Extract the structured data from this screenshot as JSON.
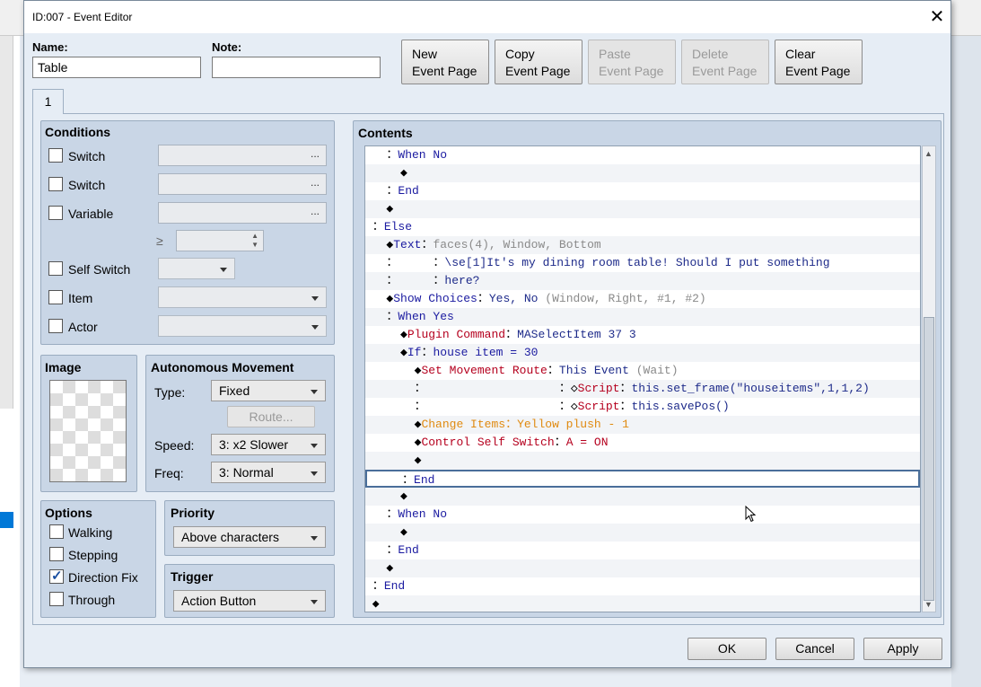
{
  "dialog": {
    "title": "ID:007 - Event Editor",
    "name_label": "Name:",
    "name_value": "Table",
    "note_label": "Note:",
    "note_value": "",
    "page_buttons": [
      {
        "line1": "New",
        "line2": "Event Page",
        "enabled": true
      },
      {
        "line1": "Copy",
        "line2": "Event Page",
        "enabled": true
      },
      {
        "line1": "Paste",
        "line2": "Event Page",
        "enabled": false
      },
      {
        "line1": "Delete",
        "line2": "Event Page",
        "enabled": false
      },
      {
        "line1": "Clear",
        "line2": "Event Page",
        "enabled": true
      }
    ],
    "tab_label": "1",
    "close_icon": "close-icon"
  },
  "conditions": {
    "title": "Conditions",
    "switch1": "Switch",
    "switch2": "Switch",
    "variable": "Variable",
    "ellipsis": "...",
    "ge_symbol": "≥",
    "self_switch": "Self Switch",
    "item": "Item",
    "actor": "Actor"
  },
  "image": {
    "title": "Image"
  },
  "autonomous": {
    "title": "Autonomous Movement",
    "type_label": "Type:",
    "type_value": "Fixed",
    "route_button": "Route...",
    "speed_label": "Speed:",
    "speed_value": "3: x2 Slower",
    "freq_label": "Freq:",
    "freq_value": "3: Normal"
  },
  "options": {
    "title": "Options",
    "walking": "Walking",
    "stepping": "Stepping",
    "direction_fix": "Direction Fix",
    "through": "Through",
    "checked": {
      "walking": false,
      "stepping": false,
      "direction_fix": true,
      "through": false
    }
  },
  "priority": {
    "title": "Priority",
    "value": "Above characters"
  },
  "trigger": {
    "title": "Trigger",
    "value": "Action Button"
  },
  "contents": {
    "title": "Contents",
    "rows": [
      [
        {
          "t": "   ：",
          "c": "c-black"
        },
        {
          "t": "When No",
          "c": "c-blue"
        }
      ],
      [
        {
          "t": "     ◆",
          "c": "c-black"
        }
      ],
      [
        {
          "t": "   ：",
          "c": "c-black"
        },
        {
          "t": "End",
          "c": "c-blue"
        }
      ],
      [
        {
          "t": "   ◆",
          "c": "c-black"
        }
      ],
      [
        {
          "t": " ：",
          "c": "c-black"
        },
        {
          "t": "Else",
          "c": "c-blue"
        }
      ],
      [
        {
          "t": "   ◆",
          "c": "c-black"
        },
        {
          "t": "Text",
          "c": "c-blue"
        },
        {
          "t": "：",
          "c": "c-black"
        },
        {
          "t": "faces(4), Window, Bottom",
          "c": "c-gray"
        }
      ],
      [
        {
          "t": "   ：     ：",
          "c": "c-black"
        },
        {
          "t": "\\se[1]It's my dining room table! Should I put something",
          "c": "c-dblue"
        }
      ],
      [
        {
          "t": "   ：     ：",
          "c": "c-black"
        },
        {
          "t": "here?",
          "c": "c-dblue"
        }
      ],
      [
        {
          "t": "   ◆",
          "c": "c-black"
        },
        {
          "t": "Show Choices",
          "c": "c-blue"
        },
        {
          "t": "：",
          "c": "c-black"
        },
        {
          "t": "Yes, No ",
          "c": "c-dblue"
        },
        {
          "t": "(Window, Right, #1, #2)",
          "c": "c-gray"
        }
      ],
      [
        {
          "t": "   ：",
          "c": "c-black"
        },
        {
          "t": "When Yes",
          "c": "c-blue"
        }
      ],
      [
        {
          "t": "     ◆",
          "c": "c-black"
        },
        {
          "t": "Plugin Command",
          "c": "c-red"
        },
        {
          "t": "：",
          "c": "c-black"
        },
        {
          "t": "MASelectItem 37 3",
          "c": "c-dblue"
        }
      ],
      [
        {
          "t": "     ◆",
          "c": "c-black"
        },
        {
          "t": "If",
          "c": "c-blue"
        },
        {
          "t": "：",
          "c": "c-black"
        },
        {
          "t": "house item = 30",
          "c": "c-blue"
        }
      ],
      [
        {
          "t": "       ◆",
          "c": "c-black"
        },
        {
          "t": "Set Movement Route",
          "c": "c-red"
        },
        {
          "t": "：",
          "c": "c-black"
        },
        {
          "t": "This Event ",
          "c": "c-dblue"
        },
        {
          "t": "(Wait)",
          "c": "c-gray"
        }
      ],
      [
        {
          "t": "       ：                   ：◇",
          "c": "c-black"
        },
        {
          "t": "Script",
          "c": "c-red"
        },
        {
          "t": "：",
          "c": "c-black"
        },
        {
          "t": "this.set_frame(\"houseitems\",1,1,2)",
          "c": "c-dblue"
        }
      ],
      [
        {
          "t": "       ：                   ：◇",
          "c": "c-black"
        },
        {
          "t": "Script",
          "c": "c-red"
        },
        {
          "t": "：",
          "c": "c-black"
        },
        {
          "t": "this.savePos()",
          "c": "c-dblue"
        }
      ],
      [
        {
          "t": "       ◆",
          "c": "c-black"
        },
        {
          "t": "Change Items",
          "c": "c-orange"
        },
        {
          "t": "：",
          "c": "c-orange"
        },
        {
          "t": "Yellow plush - 1",
          "c": "c-orange"
        }
      ],
      [
        {
          "t": "       ◆",
          "c": "c-black"
        },
        {
          "t": "Control Self Switch",
          "c": "c-red"
        },
        {
          "t": "：",
          "c": "c-black"
        },
        {
          "t": "A = ON",
          "c": "c-red"
        }
      ],
      [
        {
          "t": "       ◆",
          "c": "c-black"
        }
      ],
      [
        {
          "t": "     ：",
          "c": "c-black"
        },
        {
          "t": "End",
          "c": "c-blue"
        }
      ],
      [
        {
          "t": "     ◆",
          "c": "c-black"
        }
      ],
      [
        {
          "t": "   ：",
          "c": "c-black"
        },
        {
          "t": "When No",
          "c": "c-blue"
        }
      ],
      [
        {
          "t": "     ◆",
          "c": "c-black"
        }
      ],
      [
        {
          "t": "   ：",
          "c": "c-black"
        },
        {
          "t": "End",
          "c": "c-blue"
        }
      ],
      [
        {
          "t": "   ◆",
          "c": "c-black"
        }
      ],
      [
        {
          "t": " ：",
          "c": "c-black"
        },
        {
          "t": "End",
          "c": "c-blue"
        }
      ],
      [
        {
          "t": " ◆",
          "c": "c-black"
        }
      ]
    ],
    "selected_row": 18
  },
  "footer": {
    "ok": "OK",
    "cancel": "Cancel",
    "apply": "Apply"
  }
}
